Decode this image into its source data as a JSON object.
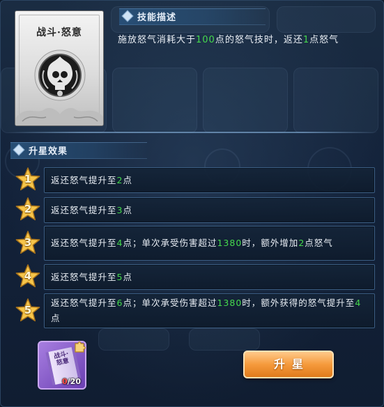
{
  "skill": {
    "name": "战斗·怒意"
  },
  "description": {
    "header": "技能描述",
    "segments": [
      {
        "text": "施放怒气消耗大于",
        "highlight": false
      },
      {
        "text": "100",
        "highlight": true
      },
      {
        "text": "点的怒气技时，返还",
        "highlight": false
      },
      {
        "text": "1",
        "highlight": true
      },
      {
        "text": "点怒气",
        "highlight": false
      }
    ]
  },
  "star_effects": {
    "header": "升星效果",
    "rows": [
      {
        "star": "1",
        "segments": [
          {
            "text": "返还怒气提升至",
            "highlight": false
          },
          {
            "text": "2",
            "highlight": true
          },
          {
            "text": "点",
            "highlight": false
          }
        ]
      },
      {
        "star": "2",
        "segments": [
          {
            "text": "返还怒气提升至",
            "highlight": false
          },
          {
            "text": "3",
            "highlight": true
          },
          {
            "text": "点",
            "highlight": false
          }
        ]
      },
      {
        "star": "3",
        "segments": [
          {
            "text": "返还怒气提升至",
            "highlight": false
          },
          {
            "text": "4",
            "highlight": true
          },
          {
            "text": "点；单次承受伤害超过",
            "highlight": false
          },
          {
            "text": "1380",
            "highlight": true
          },
          {
            "text": "时，额外增加",
            "highlight": false
          },
          {
            "text": "2",
            "highlight": true
          },
          {
            "text": "点怒气",
            "highlight": false
          }
        ]
      },
      {
        "star": "4",
        "segments": [
          {
            "text": "返还怒气提升至",
            "highlight": false
          },
          {
            "text": "5",
            "highlight": true
          },
          {
            "text": "点",
            "highlight": false
          }
        ]
      },
      {
        "star": "5",
        "segments": [
          {
            "text": "返还怒气提升至",
            "highlight": false
          },
          {
            "text": "6",
            "highlight": true
          },
          {
            "text": "点；单次承受伤害超过",
            "highlight": false
          },
          {
            "text": "1380",
            "highlight": true
          },
          {
            "text": "时，额外获得的怒气提升至",
            "highlight": false
          },
          {
            "text": "4",
            "highlight": true
          },
          {
            "text": "点",
            "highlight": false
          }
        ]
      }
    ]
  },
  "material": {
    "label": "战斗·怒意",
    "count_current": "0",
    "count_total": "/20",
    "icon": "skill-scroll-icon"
  },
  "button": {
    "label": "升星"
  },
  "colors": {
    "highlight": "#45d94d",
    "count_insufficient": "#ff4b4b",
    "button": "#f59a3c",
    "star": "#f7c64a"
  }
}
